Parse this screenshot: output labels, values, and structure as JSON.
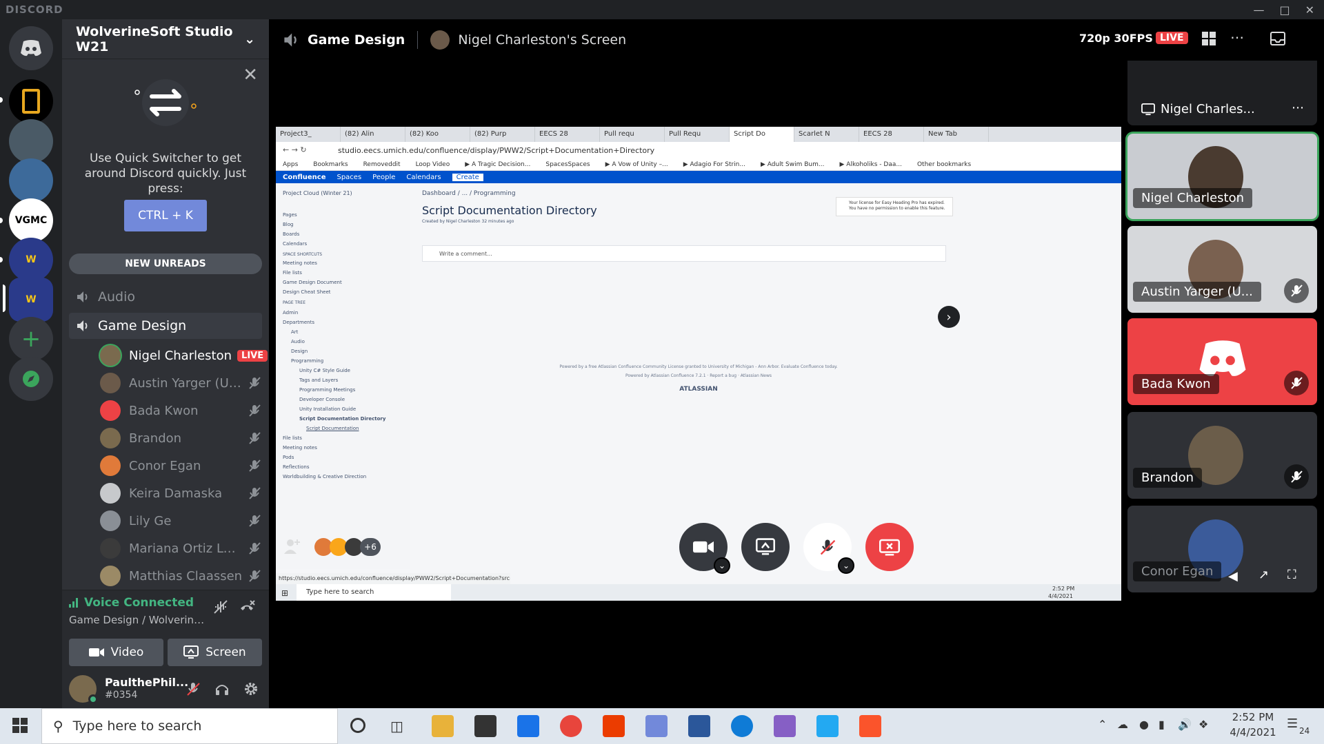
{
  "titlebar": {
    "brand": "DISCORD"
  },
  "server": {
    "name": "WolverineSoft Studio W21"
  },
  "quick_switcher": {
    "text": "Use Quick Switcher to get around Discord quickly. Just press:",
    "button": "CTRL + K"
  },
  "new_unreads": "NEW UNREADS",
  "channels": [
    {
      "name": "Audio"
    },
    {
      "name": "Game Design"
    }
  ],
  "voice_users": [
    {
      "name": "Nigel Charleston",
      "live": "LIVE",
      "speaking": true,
      "color": "#3ba55c"
    },
    {
      "name": "Austin Yarger (UMi...",
      "color": "#6b5a4a"
    },
    {
      "name": "Bada Kwon",
      "color": "#ed4245"
    },
    {
      "name": "Brandon",
      "color": "#7a6a4e"
    },
    {
      "name": "Conor Egan",
      "color": "#e07a3a"
    },
    {
      "name": "Keira Damaska",
      "color": "#c7c9cc"
    },
    {
      "name": "Lily Ge",
      "color": "#8a8f96"
    },
    {
      "name": "Mariana Ortiz Luna",
      "color": "#3b3b3b"
    },
    {
      "name": "Matthias Claassen",
      "color": "#9b8a66"
    }
  ],
  "voice_panel": {
    "status": "Voice Connected",
    "sub": "Game Design / WolverineS...",
    "video": "Video",
    "screen": "Screen"
  },
  "user": {
    "name": "PaulthePhil...",
    "tag": "#0354"
  },
  "main_header": {
    "channel": "Game Design",
    "screen_title": "Nigel Charleston's Screen",
    "quality": "720p 30FPS",
    "live": "LIVE"
  },
  "tiles": [
    {
      "label": "Nigel Charles...",
      "type": "screen"
    },
    {
      "label": "Nigel Charleston",
      "type": "camera"
    },
    {
      "label": "Austin Yarger (U...",
      "type": "camera"
    },
    {
      "label": "Bada Kwon",
      "type": "discord"
    },
    {
      "label": "Brandon",
      "type": "camera"
    },
    {
      "label": "Conor Egan",
      "type": "camera"
    }
  ],
  "stream": {
    "tabs": [
      "Project3_",
      "(82) Alin",
      "(82) Koo",
      "(82) Purp",
      "EECS 28",
      "Pull requ",
      "Pull Requ",
      "Script Do",
      "Scarlet N",
      "EECS 28",
      "New Tab"
    ],
    "active_tab": 7,
    "url": "studio.eecs.umich.edu/confluence/display/PWW2/Script+Documentation+Directory",
    "bookmarks": [
      "Apps",
      "Bookmarks",
      "Removeddit",
      "Loop Video",
      "▶ A Tragic Decision...",
      "SpacesSpaces",
      "▶ A Vow of Unity –...",
      "▶ Adagio For Strin...",
      "▶ Adult Swim Bum...",
      "▶ Alkoholiks - Daa...",
      "Other bookmarks"
    ],
    "cf_nav": [
      "Confluence",
      "Spaces",
      "People",
      "Calendars",
      "Create"
    ],
    "space": "Project Cloud (Winter 21)",
    "sidebar": [
      "Pages",
      "Blog",
      "Boards",
      "Calendars",
      "SPACE SHORTCUTS",
      "Meeting notes",
      "File lists",
      "Game Design Document",
      "Design Cheat Sheet",
      "PAGE TREE",
      "Admin",
      "Departments",
      "Art",
      "Audio",
      "Design",
      "Programming",
      "Unity C# Style Guide",
      "Tags and Layers",
      "Programming Meetings",
      "Developer Console",
      "Unity Installation Guide",
      "Script Documentation Directory",
      "Script Documentation",
      "File lists",
      "Meeting notes",
      "Pods",
      "Reflections",
      "Worldbuilding & Creative Direction"
    ],
    "breadcrumb": "Dashboard / ... / Programming",
    "page_title": "Script Documentation Directory",
    "page_meta": "Created by Nigel Charleston 32 minutes ago",
    "comment_placeholder": "Write a comment...",
    "license_notice": "Your license for Easy Heading Pro has expired. You have no permission to enable this feature.",
    "footer": "Powered by a free Atlassian Confluence Community License granted to University of Michigan - Ann Arbor. Evaluate Confluence today.",
    "footer2": "Powered by Atlassian Confluence 7.2.1 · Report a bug · Atlassian News",
    "atlassian": "ATLASSIAN",
    "status_url": "https://studio.eecs.umich.edu/confluence/display/PWW2/Script+Documentation?src=contex...",
    "win_search": "Type here to search",
    "win_time": "2:52 PM",
    "win_date": "4/4/2021"
  },
  "call_controls": {
    "extra_count": "+6"
  },
  "taskbar": {
    "search": "Type here to search",
    "time": "2:52 PM",
    "date": "4/4/2021",
    "notifications": "24"
  }
}
